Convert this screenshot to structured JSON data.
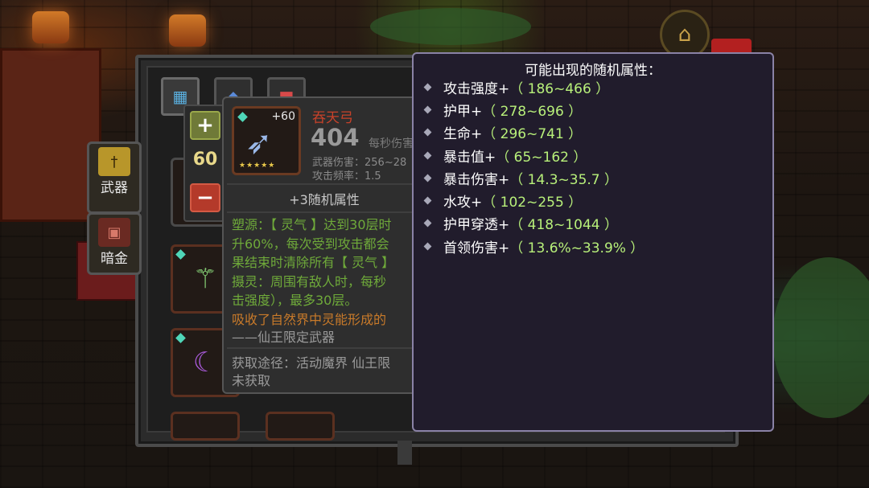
{
  "side_tabs": {
    "weapon": "武器",
    "dark_gold": "暗金"
  },
  "stepper": {
    "value": "60"
  },
  "item": {
    "name": "吞天弓",
    "level": "+60",
    "power": "404",
    "dps_label": "每秒伤害",
    "damage": "武器伤害：256~28",
    "frequency": "攻击频率：1.5",
    "random_attrs": "+3随机属性",
    "desc_lines": [
      "塑源：【 灵气 】达到30层时",
      "升60%，每次受到攻击都会",
      "果结束时清除所有【 灵气 】",
      "摄灵：周围有敌人时，每秒",
      "击强度），最多30层。"
    ],
    "lore": "吸收了自然界中灵能形成的",
    "lore_sign": "——仙王限定武器",
    "source": "获取途径：活动魔界 仙王限",
    "status": "未获取"
  },
  "attr_popup": {
    "title": "可能出现的随机属性：",
    "items": [
      {
        "name": "攻击强度+",
        "range": "（ 186~466 ）"
      },
      {
        "name": "护甲+",
        "range": "（ 278~696 ）"
      },
      {
        "name": "生命+",
        "range": "（ 296~741 ）"
      },
      {
        "name": "暴击值+",
        "range": "（ 65~162 ）"
      },
      {
        "name": "暴击伤害+",
        "range": "（ 14.3~35.7 ）"
      },
      {
        "name": "水攻+",
        "range": "（ 102~255 ）"
      },
      {
        "name": "护甲穿透+",
        "range": "（ 418~1044 ）"
      },
      {
        "name": "首领伤害+",
        "range": "（ 13.6%~33.9% ）"
      }
    ]
  },
  "colors": {
    "attr_value": "#b8f07a",
    "item_name": "#c8422a",
    "desc_green": "#6faa3a",
    "lore_orange": "#c87a2a",
    "popup_border": "#8a82a6"
  }
}
